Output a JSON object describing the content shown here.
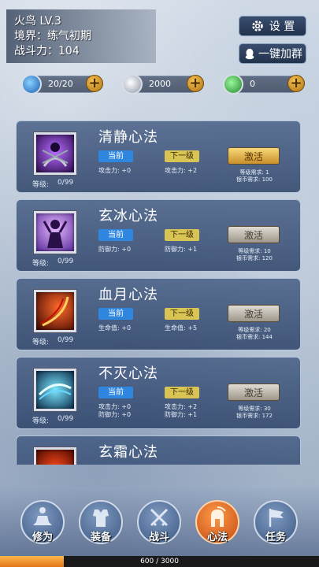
{
  "player": {
    "name_level": "火鸟 LV.3",
    "realm": "境界：练气初期",
    "power": "战斗力：104"
  },
  "buttons": {
    "settings": "设 置",
    "join_group": "一键加群"
  },
  "resources": [
    {
      "icon": "energy-orb-icon",
      "value": "20/20"
    },
    {
      "icon": "silver-coin-icon",
      "value": "2000"
    },
    {
      "icon": "jade-gem-icon",
      "value": "0"
    }
  ],
  "skills": [
    {
      "name": "清静心法",
      "level_label": "等级:",
      "level_value": "0/99",
      "current_label": "当前",
      "next_label": "下一级",
      "current_stats": [
        "攻击力: +0"
      ],
      "next_stats": [
        "攻击力: +2"
      ],
      "action": "激活",
      "action_style": "gold",
      "req_level": "等级需求: 1",
      "req_silver": "银币需求: 100"
    },
    {
      "name": "玄冰心法",
      "level_label": "等级:",
      "level_value": "0/99",
      "current_label": "当前",
      "next_label": "下一级",
      "current_stats": [
        "防御力: +0"
      ],
      "next_stats": [
        "防御力: +1"
      ],
      "action": "激活",
      "action_style": "grey",
      "req_level": "等级需求: 10",
      "req_silver": "银币需求: 120"
    },
    {
      "name": "血月心法",
      "level_label": "等级:",
      "level_value": "0/99",
      "current_label": "当前",
      "next_label": "下一级",
      "current_stats": [
        "生命值: +0"
      ],
      "next_stats": [
        "生命值: +5"
      ],
      "action": "激活",
      "action_style": "grey",
      "req_level": "等级需求: 20",
      "req_silver": "银币需求: 144"
    },
    {
      "name": "不灭心法",
      "level_label": "等级:",
      "level_value": "0/99",
      "current_label": "当前",
      "next_label": "下一级",
      "current_stats": [
        "攻击力: +0",
        "防御力: +0"
      ],
      "next_stats": [
        "攻击力: +2",
        "防御力: +1"
      ],
      "action": "激活",
      "action_style": "grey",
      "req_level": "等级需求: 30",
      "req_silver": "银币需求: 172"
    },
    {
      "name": "玄霜心法"
    }
  ],
  "nav": [
    {
      "label": "修为",
      "icon": "meditation-icon"
    },
    {
      "label": "装备",
      "icon": "armor-icon"
    },
    {
      "label": "战斗",
      "icon": "crossed-swords-icon"
    },
    {
      "label": "心法",
      "icon": "spartan-helmet-icon",
      "active": true
    },
    {
      "label": "任务",
      "icon": "flag-icon"
    }
  ],
  "xp": {
    "text": "600 / 3000",
    "fraction": 0.2
  }
}
